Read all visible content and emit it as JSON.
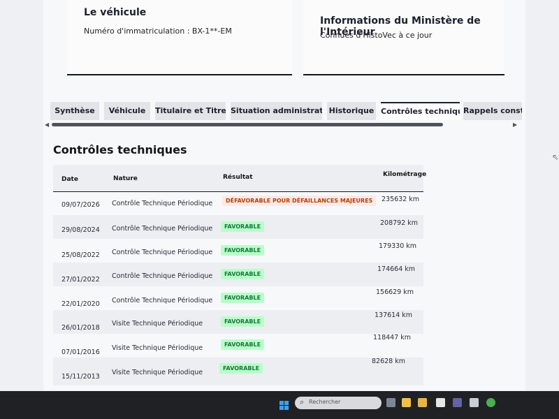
{
  "vehicle_card": {
    "title": "Le véhicule",
    "plate_label": "Numéro d'immatriculation : BX-1**-EM"
  },
  "ministry_card": {
    "title": "Informations du Ministère de l'Intérieur",
    "subtitle": "Connues d'HistoVec à ce jour"
  },
  "tabs": [
    {
      "label": "Synthèse",
      "active": false
    },
    {
      "label": "Véhicule",
      "active": false
    },
    {
      "label": "Titulaire et Titre",
      "active": false
    },
    {
      "label": "Situation administrative",
      "active": false
    },
    {
      "label": "Historique",
      "active": false
    },
    {
      "label": "Contrôles techniques",
      "active": true
    },
    {
      "label": "Rappels constru",
      "active": false
    }
  ],
  "section": {
    "title": "Contrôles techniques",
    "columns": {
      "date": "Date",
      "nature": "Nature",
      "result": "Résultat",
      "mileage": "Kilométrage"
    },
    "rows": [
      {
        "date": "09/07/2026",
        "nature": "Contrôle Technique Périodique",
        "result": "DÉFAVORABLE POUR DÉFAILLANCES MAJEURES",
        "status": "bad",
        "mileage": "235632 km"
      },
      {
        "date": "29/08/2024",
        "nature": "Contrôle Technique Périodique",
        "result": "FAVORABLE",
        "status": "ok",
        "mileage": "208792 km"
      },
      {
        "date": "25/08/2022",
        "nature": "Contrôle Technique Périodique",
        "result": "FAVORABLE",
        "status": "ok",
        "mileage": "179330 km"
      },
      {
        "date": "27/01/2022",
        "nature": "Contrôle Technique Périodique",
        "result": "FAVORABLE",
        "status": "ok",
        "mileage": "174664 km"
      },
      {
        "date": "22/01/2020",
        "nature": "Contrôle Technique Périodique",
        "result": "FAVORABLE",
        "status": "ok",
        "mileage": "156629 km"
      },
      {
        "date": "26/01/2018",
        "nature": "Visite Technique Périodique",
        "result": "FAVORABLE",
        "status": "ok",
        "mileage": "137614 km"
      },
      {
        "date": "07/01/2016",
        "nature": "Visite Technique Périodique",
        "result": "FAVORABLE",
        "status": "ok",
        "mileage": "118447 km"
      },
      {
        "date": "15/11/2013",
        "nature": "Visite Technique Périodique",
        "result": "FAVORABLE",
        "status": "ok",
        "mileage": "82628 km"
      }
    ]
  },
  "taskbar": {
    "search_placeholder": "Rechercher",
    "icons": [
      "start-icon",
      "search-icon",
      "task-view-icon",
      "file-explorer-icon",
      "folder-icon",
      "document-icon",
      "teams-icon",
      "app-icon",
      "chrome-icon"
    ]
  },
  "colors": {
    "favorable_bg": "#b8fec9",
    "favorable_text": "#18753c",
    "unfavorable_bg": "#fee9e5",
    "unfavorable_text": "#b34000",
    "accent": "#1e1e2d"
  }
}
